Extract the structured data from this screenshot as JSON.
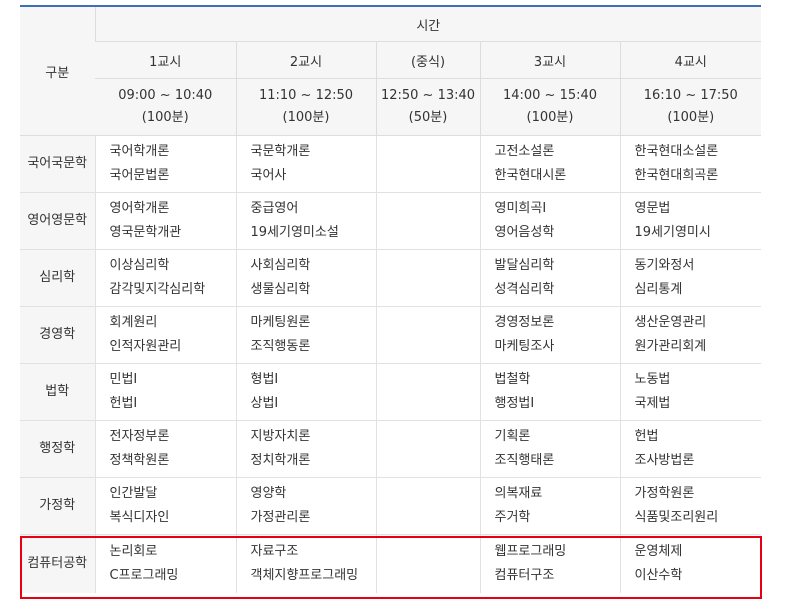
{
  "header": {
    "category": "구분",
    "time": "시간",
    "periods": [
      {
        "name": "1교시",
        "time": "09:00 ~ 10:40",
        "duration": "(100분)"
      },
      {
        "name": "2교시",
        "time": "11:10 ~ 12:50",
        "duration": "(100분)"
      },
      {
        "name": "(중식)",
        "time": "12:50 ~ 13:40",
        "duration": "(50분)"
      },
      {
        "name": "3교시",
        "time": "14:00 ~ 15:40",
        "duration": "(100분)"
      },
      {
        "name": "4교시",
        "time": "16:10 ~ 17:50",
        "duration": "(100분)"
      }
    ]
  },
  "rows": [
    {
      "dept": "국어국문학",
      "p1": [
        "국어학개론",
        "국어문법론"
      ],
      "p2": [
        "국문학개론",
        "국어사"
      ],
      "p3": [
        "고전소설론",
        "한국현대시론"
      ],
      "p4": [
        "한국현대소설론",
        "한국현대희곡론"
      ]
    },
    {
      "dept": "영어영문학",
      "p1": [
        "영어학개론",
        "영국문학개관"
      ],
      "p2": [
        "중급영어",
        "19세기영미소설"
      ],
      "p3": [
        "영미희곡Ⅰ",
        "영어음성학"
      ],
      "p4": [
        "영문법",
        "19세기영미시"
      ]
    },
    {
      "dept": "심리학",
      "p1": [
        "이상심리학",
        "감각및지각심리학"
      ],
      "p2": [
        "사회심리학",
        "생물심리학"
      ],
      "p3": [
        "발달심리학",
        "성격심리학"
      ],
      "p4": [
        "동기와정서",
        "심리통계"
      ]
    },
    {
      "dept": "경영학",
      "p1": [
        "회계원리",
        "인적자원관리"
      ],
      "p2": [
        "마케팅원론",
        "조직행동론"
      ],
      "p3": [
        "경영정보론",
        "마케팅조사"
      ],
      "p4": [
        "생산운영관리",
        "원가관리회계"
      ]
    },
    {
      "dept": "법학",
      "p1": [
        "민법Ⅰ",
        "헌법Ⅰ"
      ],
      "p2": [
        "형법Ⅰ",
        "상법Ⅰ"
      ],
      "p3": [
        "법철학",
        "행정법Ⅰ"
      ],
      "p4": [
        "노동법",
        "국제법"
      ]
    },
    {
      "dept": "행정학",
      "p1": [
        "전자정부론",
        "정책학원론"
      ],
      "p2": [
        "지방자치론",
        "정치학개론"
      ],
      "p3": [
        "기획론",
        "조직행태론"
      ],
      "p4": [
        "헌법",
        "조사방법론"
      ]
    },
    {
      "dept": "가정학",
      "p1": [
        "인간발달",
        "복식디자인"
      ],
      "p2": [
        "영양학",
        "가정관리론"
      ],
      "p3": [
        "의복재료",
        "주거학"
      ],
      "p4": [
        "가정학원론",
        "식품및조리원리"
      ]
    },
    {
      "dept": "컴퓨터공학",
      "p1": [
        "논리회로",
        "C프로그래밍"
      ],
      "p2": [
        "자료구조",
        "객체지향프로그래밍"
      ],
      "p3": [
        "웹프로그래밍",
        "컴퓨터구조"
      ],
      "p4": [
        "운영체제",
        "이산수학"
      ]
    }
  ],
  "colors": {
    "accent": "#3e6fb8",
    "highlight": "#e60012",
    "header_bg": "#f6f6f6"
  }
}
